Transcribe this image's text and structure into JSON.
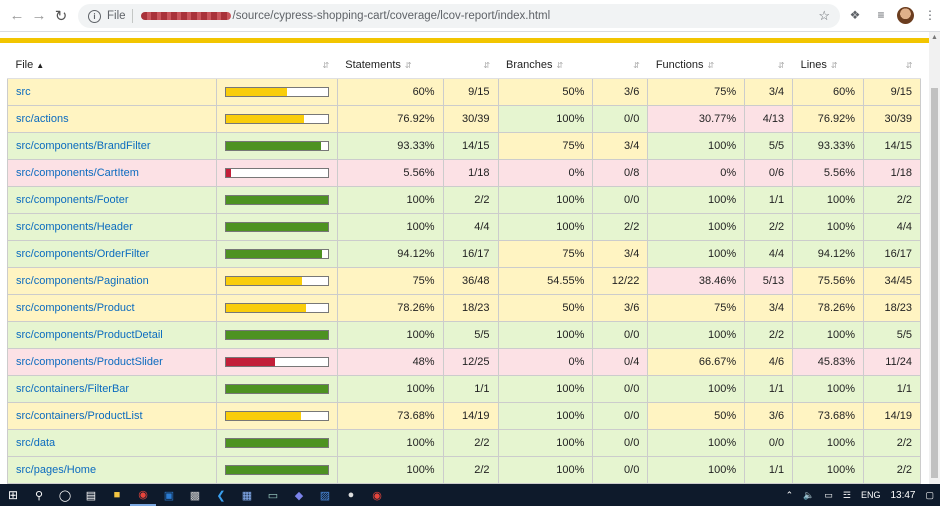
{
  "browser": {
    "file_label": "File",
    "url_path": "/source/cypress-shopping-cart/coverage/lcov-report/index.html"
  },
  "table": {
    "headers": {
      "file": "File",
      "statements": "Statements",
      "branches": "Branches",
      "functions": "Functions",
      "lines": "Lines"
    },
    "rows": [
      {
        "file": "src",
        "pct": 0.6,
        "level": "medium",
        "stmt": "60%",
        "stmt_f": "9/15",
        "br": "50%",
        "br_f": "3/6",
        "fn": "75%",
        "fn_f": "3/4",
        "ln": "60%",
        "ln_f": "9/15",
        "lv": [
          "medium",
          "medium",
          "medium",
          "medium"
        ]
      },
      {
        "file": "src/actions",
        "pct": 0.7692,
        "level": "medium",
        "stmt": "76.92%",
        "stmt_f": "30/39",
        "br": "100%",
        "br_f": "0/0",
        "fn": "30.77%",
        "fn_f": "4/13",
        "ln": "76.92%",
        "ln_f": "30/39",
        "lv": [
          "medium",
          "high",
          "low",
          "medium"
        ]
      },
      {
        "file": "src/components/BrandFilter",
        "pct": 0.9333,
        "level": "high",
        "stmt": "93.33%",
        "stmt_f": "14/15",
        "br": "75%",
        "br_f": "3/4",
        "fn": "100%",
        "fn_f": "5/5",
        "ln": "93.33%",
        "ln_f": "14/15",
        "lv": [
          "high",
          "medium",
          "high",
          "high"
        ]
      },
      {
        "file": "src/components/CartItem",
        "pct": 0.0556,
        "level": "low",
        "stmt": "5.56%",
        "stmt_f": "1/18",
        "br": "0%",
        "br_f": "0/8",
        "fn": "0%",
        "fn_f": "0/6",
        "ln": "5.56%",
        "ln_f": "1/18",
        "lv": [
          "low",
          "low",
          "low",
          "low"
        ]
      },
      {
        "file": "src/components/Footer",
        "pct": 1.0,
        "level": "high",
        "stmt": "100%",
        "stmt_f": "2/2",
        "br": "100%",
        "br_f": "0/0",
        "fn": "100%",
        "fn_f": "1/1",
        "ln": "100%",
        "ln_f": "2/2",
        "lv": [
          "high",
          "high",
          "high",
          "high"
        ]
      },
      {
        "file": "src/components/Header",
        "pct": 1.0,
        "level": "high",
        "stmt": "100%",
        "stmt_f": "4/4",
        "br": "100%",
        "br_f": "2/2",
        "fn": "100%",
        "fn_f": "2/2",
        "ln": "100%",
        "ln_f": "4/4",
        "lv": [
          "high",
          "high",
          "high",
          "high"
        ]
      },
      {
        "file": "src/components/OrderFilter",
        "pct": 0.9412,
        "level": "high",
        "stmt": "94.12%",
        "stmt_f": "16/17",
        "br": "75%",
        "br_f": "3/4",
        "fn": "100%",
        "fn_f": "4/4",
        "ln": "94.12%",
        "ln_f": "16/17",
        "lv": [
          "high",
          "medium",
          "high",
          "high"
        ]
      },
      {
        "file": "src/components/Pagination",
        "pct": 0.75,
        "level": "medium",
        "stmt": "75%",
        "stmt_f": "36/48",
        "br": "54.55%",
        "br_f": "12/22",
        "fn": "38.46%",
        "fn_f": "5/13",
        "ln": "75.56%",
        "ln_f": "34/45",
        "lv": [
          "medium",
          "medium",
          "low",
          "medium"
        ]
      },
      {
        "file": "src/components/Product",
        "pct": 0.7826,
        "level": "medium",
        "stmt": "78.26%",
        "stmt_f": "18/23",
        "br": "50%",
        "br_f": "3/6",
        "fn": "75%",
        "fn_f": "3/4",
        "ln": "78.26%",
        "ln_f": "18/23",
        "lv": [
          "medium",
          "medium",
          "medium",
          "medium"
        ]
      },
      {
        "file": "src/components/ProductDetail",
        "pct": 1.0,
        "level": "high",
        "stmt": "100%",
        "stmt_f": "5/5",
        "br": "100%",
        "br_f": "0/0",
        "fn": "100%",
        "fn_f": "2/2",
        "ln": "100%",
        "ln_f": "5/5",
        "lv": [
          "high",
          "high",
          "high",
          "high"
        ]
      },
      {
        "file": "src/components/ProductSlider",
        "pct": 0.48,
        "level": "low",
        "stmt": "48%",
        "stmt_f": "12/25",
        "br": "0%",
        "br_f": "0/4",
        "fn": "66.67%",
        "fn_f": "4/6",
        "ln": "45.83%",
        "ln_f": "11/24",
        "lv": [
          "low",
          "low",
          "medium",
          "low"
        ]
      },
      {
        "file": "src/containers/FilterBar",
        "pct": 1.0,
        "level": "high",
        "stmt": "100%",
        "stmt_f": "1/1",
        "br": "100%",
        "br_f": "0/0",
        "fn": "100%",
        "fn_f": "1/1",
        "ln": "100%",
        "ln_f": "1/1",
        "lv": [
          "high",
          "high",
          "high",
          "high"
        ]
      },
      {
        "file": "src/containers/ProductList",
        "pct": 0.7368,
        "level": "medium",
        "stmt": "73.68%",
        "stmt_f": "14/19",
        "br": "100%",
        "br_f": "0/0",
        "fn": "50%",
        "fn_f": "3/6",
        "ln": "73.68%",
        "ln_f": "14/19",
        "lv": [
          "medium",
          "high",
          "medium",
          "medium"
        ]
      },
      {
        "file": "src/data",
        "pct": 1.0,
        "level": "high",
        "stmt": "100%",
        "stmt_f": "2/2",
        "br": "100%",
        "br_f": "0/0",
        "fn": "100%",
        "fn_f": "0/0",
        "ln": "100%",
        "ln_f": "2/2",
        "lv": [
          "high",
          "high",
          "high",
          "high"
        ]
      },
      {
        "file": "src/pages/Home",
        "pct": 1.0,
        "level": "high",
        "stmt": "100%",
        "stmt_f": "2/2",
        "br": "100%",
        "br_f": "0/0",
        "fn": "100%",
        "fn_f": "1/1",
        "ln": "100%",
        "ln_f": "2/2",
        "lv": [
          "high",
          "high",
          "high",
          "high"
        ]
      }
    ]
  },
  "colors": {
    "high": "#4d9221",
    "medium": "#f9cd0b",
    "low": "#c21f39",
    "accent_strip": "#f2c500"
  },
  "taskbar": {
    "lang": "ENG",
    "time": "13:47"
  }
}
